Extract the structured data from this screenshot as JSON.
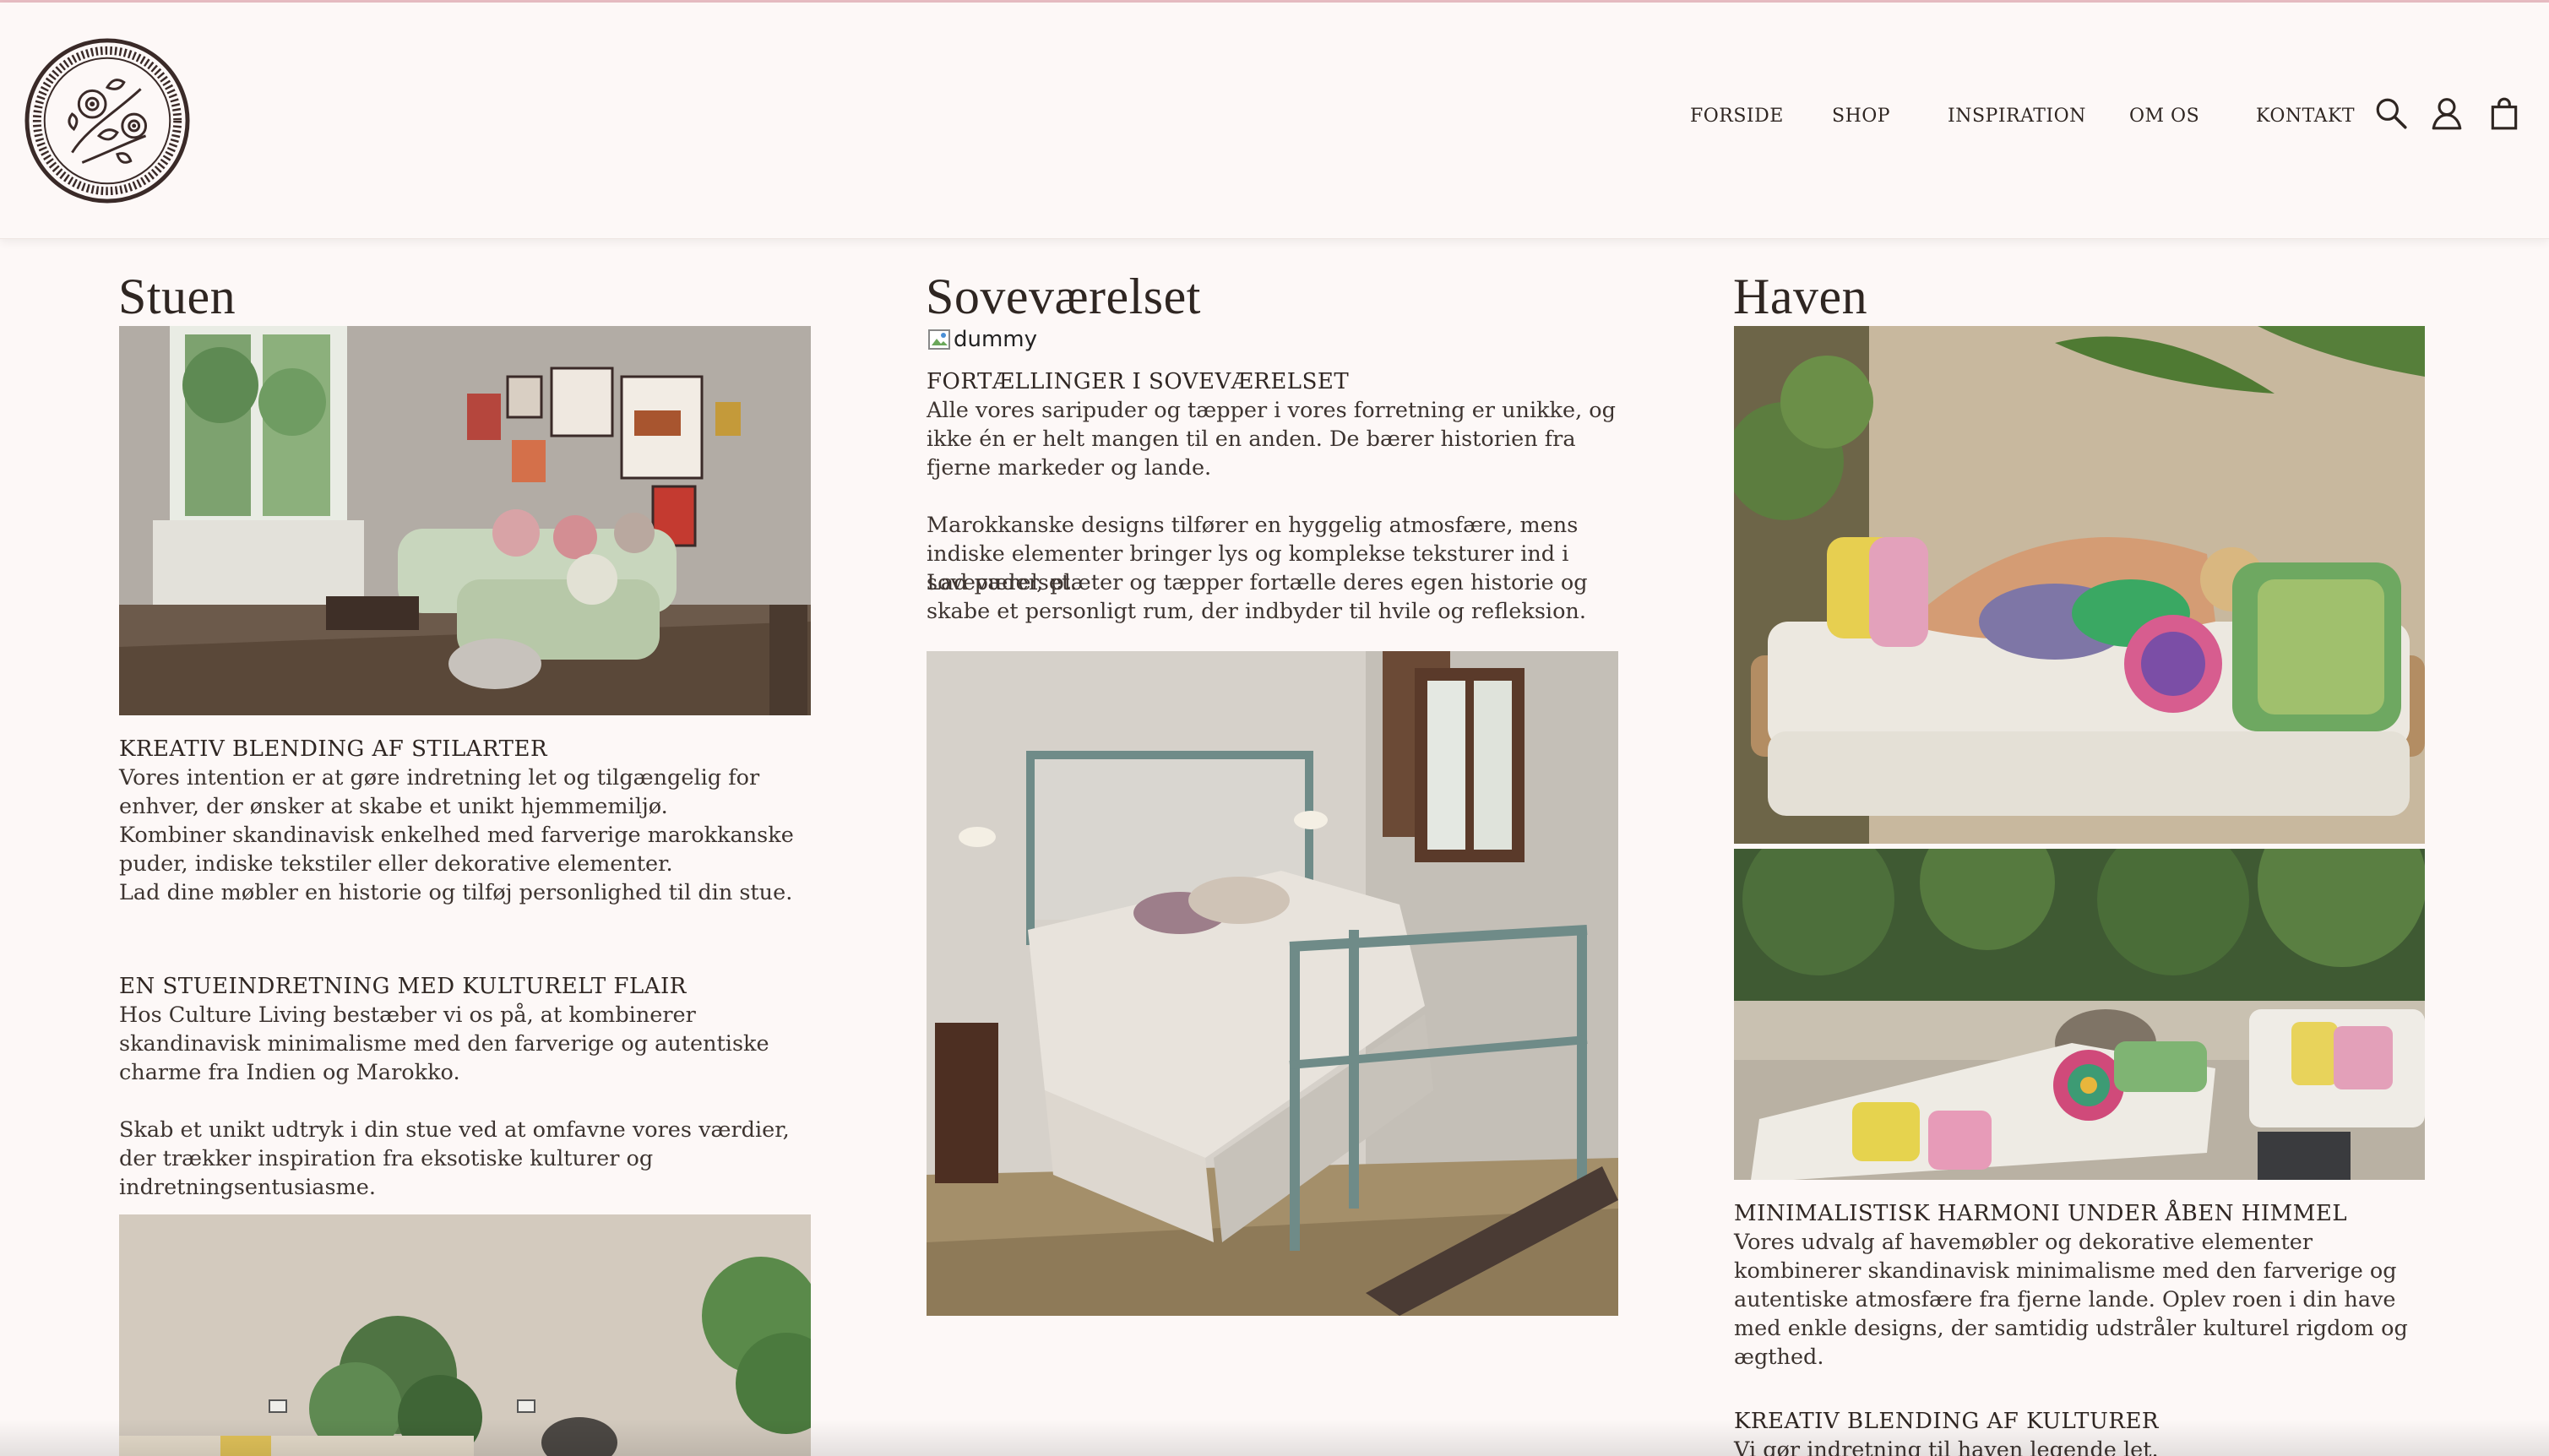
{
  "header": {
    "nav": [
      {
        "id": "forside",
        "label": "FORSIDE"
      },
      {
        "id": "shop",
        "label": "SHOP"
      },
      {
        "id": "inspiration",
        "label": "INSPIRATION"
      },
      {
        "id": "om-os",
        "label": "OM OS"
      },
      {
        "id": "kontakt",
        "label": "KONTAKT"
      }
    ],
    "icons": [
      "search-icon",
      "account-icon",
      "cart-icon"
    ]
  },
  "stuen": {
    "title": "Stuen",
    "sections": [
      {
        "heading": "KREATIV BLENDING AF STILARTER",
        "paragraphs": [
          "Vores intention er at gøre indretning let og tilgængelig for enhver, der ønsker at skabe et unikt hjemmemiljø.",
          "Kombiner skandinavisk enkelhed med farverige marokkanske puder, indiske tekstiler eller dekorative elementer.",
          "Lad dine møbler en historie og tilføj personlighed til din stue."
        ]
      },
      {
        "heading": "EN STUEINDRETNING MED KULTURELT FLAIR",
        "paragraphs": [
          "Hos Culture Living bestæber vi os på, at kombinerer skandinavisk minimalisme med den farverige og autentiske charme fra Indien og Marokko.",
          "Skab et unikt udtryk i din stue ved at omfavne vores værdier, der trækker inspiration fra eksotiske kulturer og indretningsentusiasme."
        ]
      }
    ]
  },
  "sovevaerelset": {
    "title": "Soveværelset",
    "broken_image_alt": "dummy",
    "heading": "FORTÆLLINGER I SOVEVÆRELSET",
    "paragraphs": [
      "Alle vores saripuder og tæpper i vores forretning er unikke, og ikke én er helt mangen til en anden. De bærer historien fra fjerne markeder og lande.",
      "Marokkanske designs tilfører en hyggelig atmosfære, mens indiske elementer bringer lys og komplekse teksturer ind i soveværelset.",
      "Lad puder, plæter og tæpper fortælle deres egen historie og skabe et personligt rum, der indbyder til hvile og refleksion."
    ]
  },
  "haven": {
    "title": "Haven",
    "sections": [
      {
        "heading": "MINIMALISTISK HARMONI UNDER ÅBEN HIMMEL",
        "paragraphs": [
          "Vores udvalg af havemøbler og dekorative elementer kombinerer skandinavisk minimalisme med den farverige og autentiske atmosfære fra fjerne lande. Oplev roen i din have med enkle designs, der samtidig udstråler kulturel rigdom og ægthed."
        ]
      },
      {
        "heading": "KREATIV BLENDING AF KULTURER",
        "paragraphs": [
          "Vi gør indretning til haven legende let."
        ]
      }
    ]
  }
}
